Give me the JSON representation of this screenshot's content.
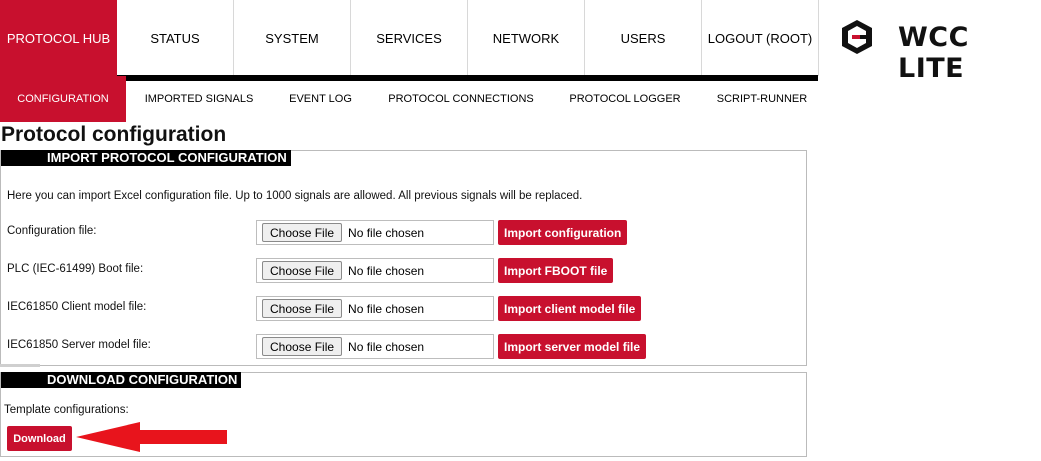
{
  "topnav": {
    "tabs": [
      {
        "label": "PROTOCOL HUB"
      },
      {
        "label": "STATUS"
      },
      {
        "label": "SYSTEM"
      },
      {
        "label": "SERVICES"
      },
      {
        "label": "NETWORK"
      },
      {
        "label": "USERS"
      },
      {
        "label": "LOGOUT (ROOT)"
      }
    ],
    "brand": "WCC LITE"
  },
  "subnav": {
    "tabs": [
      {
        "label": "CONFIGURATION"
      },
      {
        "label": "IMPORTED SIGNALS"
      },
      {
        "label": "EVENT LOG"
      },
      {
        "label": "PROTOCOL CONNECTIONS"
      },
      {
        "label": "PROTOCOL LOGGER"
      },
      {
        "label": "SCRIPT-RUNNER"
      }
    ]
  },
  "page": {
    "title": "Protocol configuration"
  },
  "import_section": {
    "heading": "IMPORT PROTOCOL CONFIGURATION",
    "intro": "Here you can import Excel configuration file. Up to 1000 signals are allowed. All previous signals will be replaced.",
    "rows": [
      {
        "label": "Configuration file:",
        "choose": "Choose File",
        "status": "No file chosen",
        "action": "Import configuration"
      },
      {
        "label": "PLC (IEC-61499) Boot file:",
        "choose": "Choose File",
        "status": "No file chosen",
        "action": "Import FBOOT file"
      },
      {
        "label": "IEC61850 Client model file:",
        "choose": "Choose File",
        "status": "No file chosen",
        "action": "Import client model file"
      },
      {
        "label": "IEC61850 Server model file:",
        "choose": "Choose File",
        "status": "No file chosen",
        "action": "Import server model file"
      }
    ]
  },
  "download_section": {
    "heading": "DOWNLOAD CONFIGURATION",
    "label": "Template configurations:",
    "button": "Download"
  },
  "colors": {
    "accent": "#c8102e",
    "annotation_arrow": "#e8141c"
  },
  "icons": {
    "brand_logo": "wcc-logo-icon",
    "annotation": "red-arrow-annotation"
  }
}
